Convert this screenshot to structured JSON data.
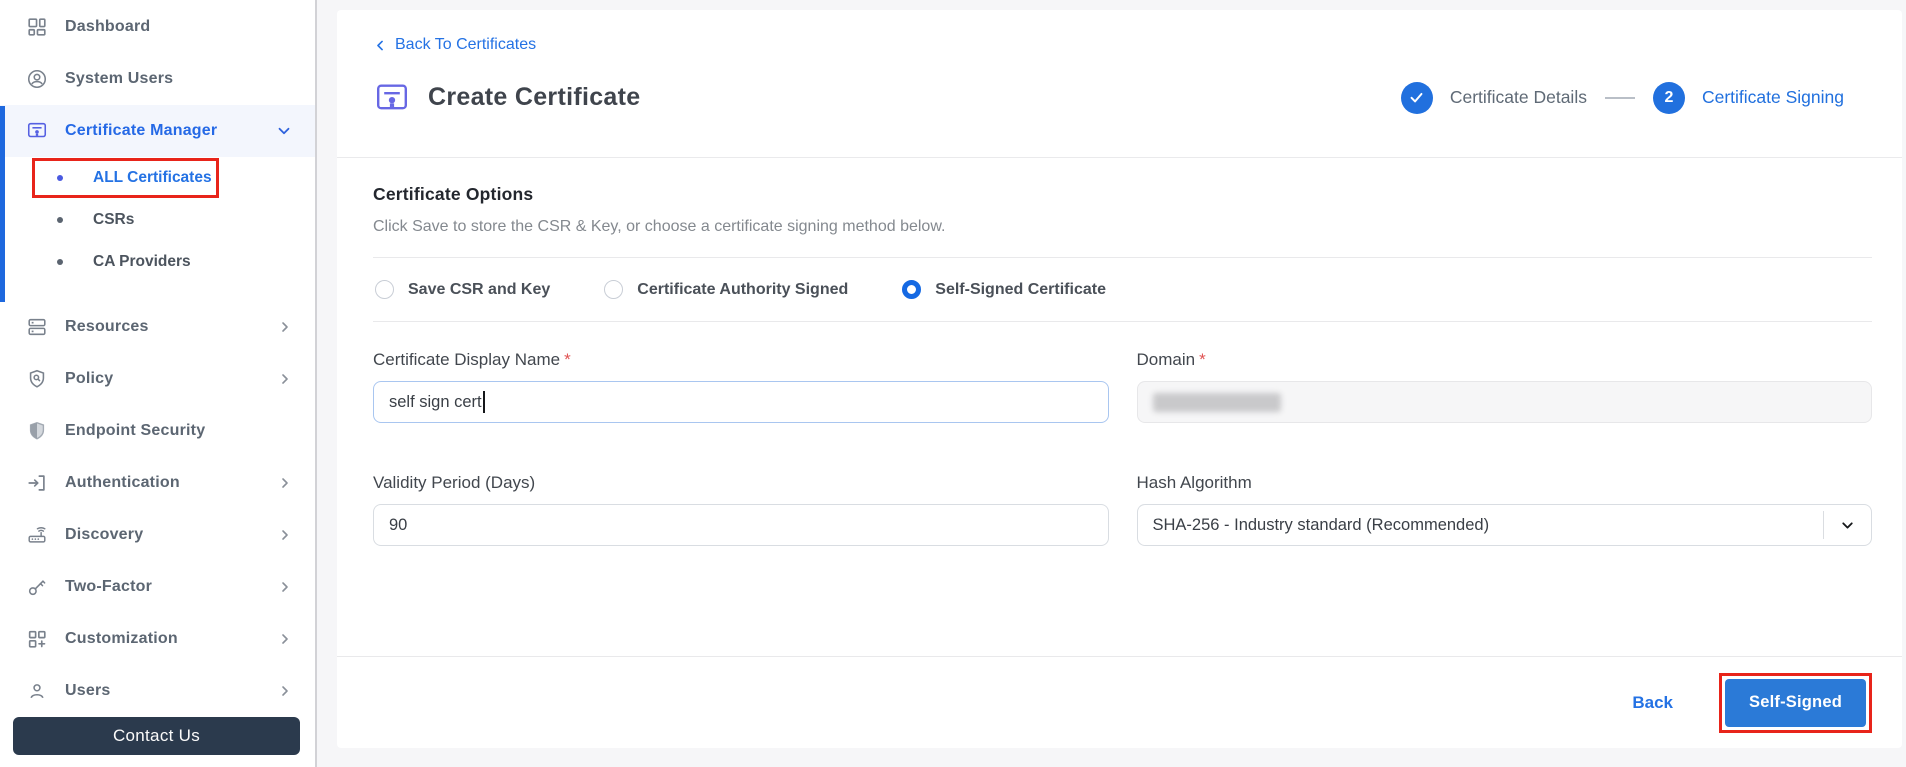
{
  "sidebar": {
    "items": [
      {
        "label": "Dashboard",
        "icon": "dashboard-icon"
      },
      {
        "label": "System Users",
        "icon": "system-users-icon"
      },
      {
        "label": "Certificate Manager",
        "icon": "certificate-manager-icon",
        "chevron": "down",
        "active": true
      },
      {
        "label": "Resources",
        "icon": "resources-icon",
        "chevron": "right"
      },
      {
        "label": "Policy",
        "icon": "policy-icon",
        "chevron": "right"
      },
      {
        "label": "Endpoint Security",
        "icon": "endpoint-security-icon"
      },
      {
        "label": "Authentication",
        "icon": "authentication-icon",
        "chevron": "right"
      },
      {
        "label": "Discovery",
        "icon": "discovery-icon",
        "chevron": "right"
      },
      {
        "label": "Two-Factor",
        "icon": "two-factor-icon",
        "chevron": "right"
      },
      {
        "label": "Customization",
        "icon": "customization-icon",
        "chevron": "right"
      },
      {
        "label": "Users",
        "icon": "users-icon",
        "chevron": "right"
      }
    ],
    "certificate_manager_submenu": [
      {
        "label": "ALL Certificates",
        "active": true,
        "annotated": true
      },
      {
        "label": "CSRs",
        "active": false
      },
      {
        "label": "CA Providers",
        "active": false
      }
    ],
    "contact_button_label": "Contact Us"
  },
  "header": {
    "back_link": "Back To Certificates",
    "title": "Create Certificate",
    "steps": [
      {
        "label": "Certificate Details",
        "status": "complete"
      },
      {
        "label": "Certificate Signing",
        "number": "2",
        "status": "current"
      }
    ]
  },
  "form": {
    "section_title": "Certificate Options",
    "section_subtitle": "Click Save to store the CSR & Key, or choose a certificate signing method below.",
    "signing_options": [
      {
        "label": "Save CSR and Key",
        "selected": false
      },
      {
        "label": "Certificate Authority Signed",
        "selected": false
      },
      {
        "label": "Self-Signed Certificate",
        "selected": true
      }
    ],
    "fields": {
      "display_name": {
        "label": "Certificate Display Name",
        "required": "*",
        "value": "self sign cert"
      },
      "domain": {
        "label": "Domain",
        "required": "*",
        "value_redacted": true
      },
      "validity": {
        "label": "Validity Period (Days)",
        "value": "90"
      },
      "hash_algorithm": {
        "label": "Hash Algorithm",
        "value": "SHA-256 - Industry standard (Recommended)"
      }
    },
    "footer": {
      "back_label": "Back",
      "submit_label": "Self-Signed"
    }
  },
  "colors": {
    "accent_blue": "#2472e4",
    "stepper_blue": "#2170de",
    "annotation_red": "#e8241a",
    "button_blue": "#2b7ad7",
    "contact_navy": "#2b3a4d",
    "sidebar_active_bg": "#f3f6fd"
  }
}
